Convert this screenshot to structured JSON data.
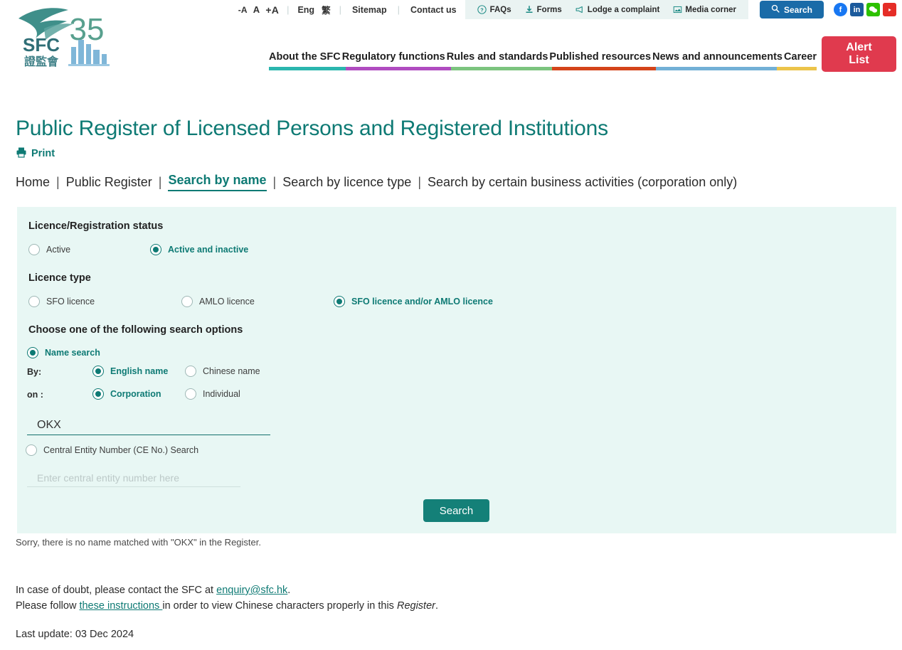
{
  "topbar": {
    "text_size": {
      "decrease": "-A",
      "normal": "A",
      "increase": "+A"
    },
    "separator": "|",
    "lang_en": "Eng",
    "lang_zh": "繁",
    "sitemap": "Sitemap",
    "contact": "Contact us",
    "utilities": [
      {
        "label": "FAQs",
        "icon": "question-circle-icon"
      },
      {
        "label": "Forms",
        "icon": "download-icon"
      },
      {
        "label": "Lodge a complaint",
        "icon": "megaphone-icon"
      },
      {
        "label": "Media corner",
        "icon": "image-icon"
      }
    ],
    "search_label": "Search",
    "socials": [
      {
        "name": "facebook",
        "glyph": "f",
        "color": "#1877f2"
      },
      {
        "name": "linkedin",
        "glyph": "in",
        "color": "#1b5a9c"
      },
      {
        "name": "wechat",
        "glyph": "✉",
        "color": "#2dc100"
      },
      {
        "name": "youtube",
        "glyph": "▶",
        "color": "#e52d27"
      }
    ]
  },
  "logo": {
    "acronym": "SFC",
    "chinese": "證監會",
    "anniversary": "35"
  },
  "nav": {
    "items": [
      {
        "label": "About the SFC",
        "color": "#2bb6ae"
      },
      {
        "label": "Regulatory functions",
        "color": "#b04cc0"
      },
      {
        "label": "Rules and standards",
        "color": "#7cc47f"
      },
      {
        "label": "Published resources",
        "color": "#d4441a"
      },
      {
        "label": "News and announcements",
        "color": "#72b0d6"
      },
      {
        "label": "Career",
        "color": "#ecc44a"
      }
    ],
    "alert_list": "Alert\nList",
    "alert_list_line1": "Alert",
    "alert_list_line2": "List"
  },
  "page": {
    "title": "Public Register of Licensed Persons and Registered Institutions",
    "print_label": "Print",
    "title_color": "#0e7a74"
  },
  "breadcrumb": {
    "separator": "|",
    "items": [
      {
        "label": "Home",
        "active": false
      },
      {
        "label": "Public Register",
        "active": false
      },
      {
        "label": "Search by name",
        "active": true
      },
      {
        "label": "Search by licence type",
        "active": false
      },
      {
        "label": "Search by certain business activities (corporation only)",
        "active": false
      }
    ]
  },
  "form": {
    "status_heading": "Licence/Registration status",
    "status_options": [
      {
        "label": "Active",
        "selected": false
      },
      {
        "label": "Active and inactive",
        "selected": true
      }
    ],
    "licence_heading": "Licence type",
    "licence_options": [
      {
        "label": "SFO licence",
        "selected": false
      },
      {
        "label": "AMLO licence",
        "selected": false
      },
      {
        "label": "SFO licence and/or AMLO licence",
        "selected": true
      }
    ],
    "search_options_heading": "Choose one of the following search options",
    "name_search": {
      "label": "Name search",
      "selected": true
    },
    "by_label": "By:",
    "by_options": [
      {
        "label": "English name",
        "selected": true
      },
      {
        "label": "Chinese name",
        "selected": false
      }
    ],
    "on_label": "on :",
    "on_options": [
      {
        "label": "Corporation",
        "selected": true
      },
      {
        "label": "Individual",
        "selected": false
      }
    ],
    "name_value": "OKX",
    "name_placeholder": "",
    "ce_search": {
      "label": "Central Entity Number (CE No.) Search",
      "selected": false
    },
    "ce_value": "",
    "ce_placeholder": "Enter central entity number here",
    "submit_label": "Search",
    "panel_bg": "#e8f7f4",
    "accent": "#0e7a74"
  },
  "result": {
    "message": "Sorry, there is no name matched with \"OKX\" in the Register."
  },
  "footer": {
    "line1_pre": "In case of doubt, please contact the SFC at ",
    "line1_link": "enquiry@sfc.hk",
    "line1_post": ".",
    "line2_pre": "Please follow ",
    "line2_link": "these instructions ",
    "line2_mid": "in order to view Chinese characters properly in this ",
    "line2_em": "Register",
    "line2_post": ".",
    "last_update": "Last update: 03 Dec 2024"
  }
}
